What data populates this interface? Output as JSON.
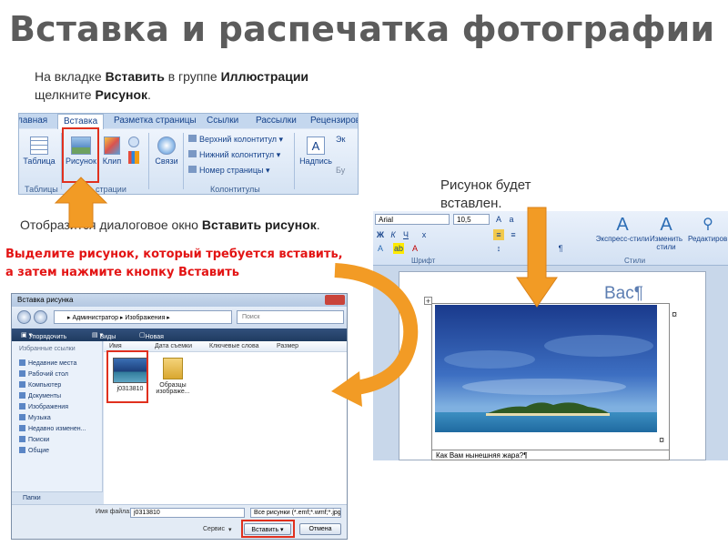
{
  "title": "Вставка и распечатка фотографии",
  "instructions": {
    "step1_a": "На вкладке ",
    "step1_b": "Вставить",
    "step1_c": " в группе ",
    "step1_d": "Иллюстрации",
    "step1_e": "щелкните ",
    "step1_f": "Рисунок",
    "step1_g": ".",
    "step2_a": "Отобразится диалоговое окно ",
    "step2_b": "Вставить рисунок",
    "step2_c": ".",
    "step3": "Выделите рисунок, который требуется вставить,  а затем нажмите кнопку Вставить",
    "step4": "Рисунок будет вставлен."
  },
  "ribbon": {
    "tabs": [
      "лавная",
      "Вставка",
      "Разметка страницы",
      "Ссылки",
      "Рассылки",
      "Рецензиров"
    ],
    "buttons": {
      "table": "Таблица",
      "picture": "Рисунок",
      "clip": "Клип",
      "links": "Связи",
      "header": "Верхний колонтитул",
      "footer": "Нижний колонтитул",
      "page_number": "Номер страницы",
      "textbox": "Надпись",
      "ek": "Эк",
      "bu": "Бу"
    },
    "groups": {
      "tables": "Таблицы",
      "illustrations": "страции",
      "header_footer": "Колонтитулы"
    }
  },
  "dialog": {
    "title": "Вставка рисунка",
    "path": "▸ Администратор ▸ Изображения ▸",
    "search_placeholder": "Поиск",
    "toolbar": {
      "organize": "Упорядочить",
      "views": "Виды",
      "new_folder": "Новая папка"
    },
    "sidebar_header": "Избранные ссылки",
    "sidebar_items": [
      "Недавние места",
      "Рабочий стол",
      "Компьютер",
      "Документы",
      "Изображения",
      "Музыка",
      "Недавно изменен...",
      "Поиски",
      "Общие"
    ],
    "folders_label": "Папки",
    "columns": [
      "Имя",
      "Дата съемки",
      "Ключевые слова",
      "Размер"
    ],
    "files": [
      {
        "name": "j0313810"
      },
      {
        "name": "Образцы изображе..."
      }
    ],
    "filename_label": "Имя файла:",
    "filename_value": "j0313810",
    "filetype_value": "Все рисунки (*.emf;*.wmf;*.jpg;",
    "service_label": "Сервис",
    "insert_button": "Вставить",
    "cancel_button": "Отмена"
  },
  "word": {
    "font_name": "Arial",
    "font_size": "10,5",
    "group_font": "Шрифт",
    "group_styles": "Стили",
    "express_styles": "Экспресс-стили",
    "change_styles": "Изменить стили",
    "editing": "Редактиров...",
    "heading": "Вас¶",
    "caption": "Как Вам нынешняя жара?¶"
  },
  "colors": {
    "arrow_orange": "#f29b25",
    "highlight_red": "#e0301e",
    "title_gray": "#5c5c5c",
    "alert_red": "#e31414"
  }
}
